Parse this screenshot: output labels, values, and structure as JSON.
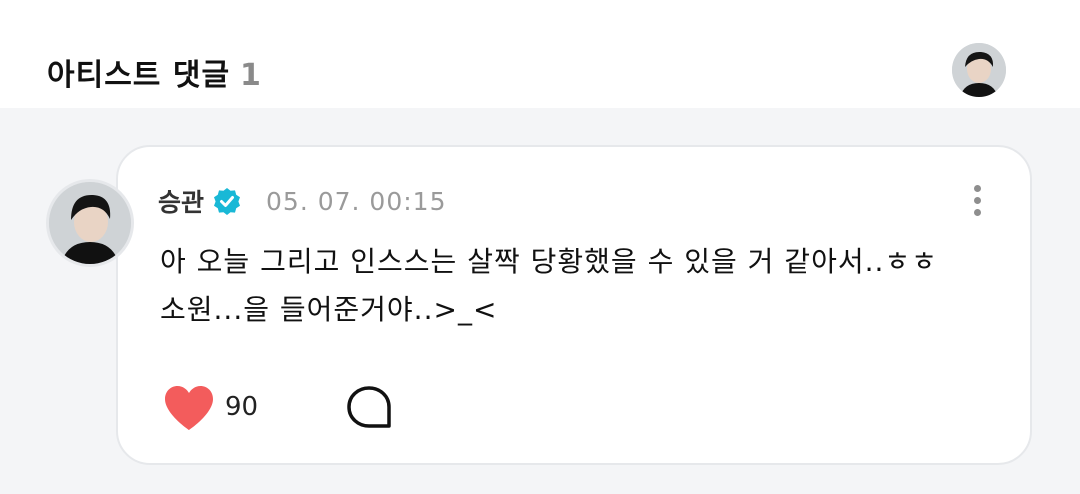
{
  "header": {
    "title": "아티스트 댓글",
    "count": "1",
    "avatar_icon": "artist-avatar"
  },
  "comment": {
    "author": "승관",
    "verified_icon": "verified-badge-icon",
    "verified_color": "#19b8d6",
    "timestamp": "05. 07. 00:15",
    "text_lines": [
      "아 오늘 그리고 인스스는 살짝 당황했을 수 있을 거 같아서..ㅎㅎ",
      "소원...을 들어준거야..>_<"
    ],
    "likes": "90",
    "like_color": "#f35c5c",
    "more_icon": "more-vertical-icon",
    "reply_icon": "reply-bubble-icon"
  }
}
